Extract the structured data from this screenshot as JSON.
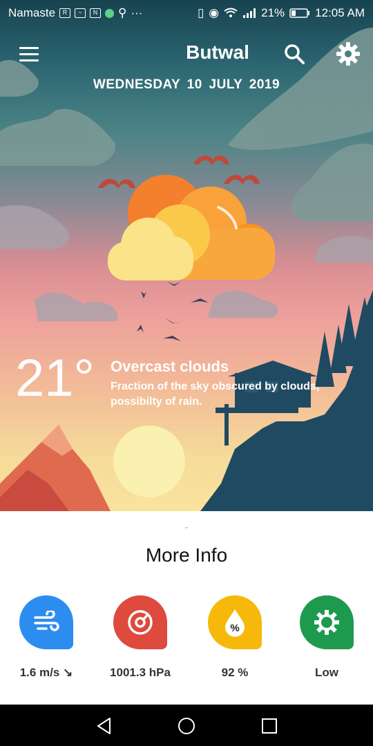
{
  "status_bar": {
    "carrier": "Namaste",
    "battery": "21%",
    "time": "12:05 AM"
  },
  "header": {
    "city": "Butwal",
    "date": "WEDNESDAY 10 JULY 2019"
  },
  "current": {
    "temperature": "21°",
    "condition": "Overcast clouds",
    "description": "Fraction of the sky obscured by clouds, possibilty of rain."
  },
  "more_info": {
    "title": "More Info",
    "items": [
      {
        "icon": "wind-icon",
        "value": "1.6 m/s ↘",
        "color": "#2d8cf0"
      },
      {
        "icon": "pressure-icon",
        "value": "1001.3 hPa",
        "color": "#de4a3e"
      },
      {
        "icon": "humidity-icon",
        "value": "92 %",
        "color": "#f6b90b"
      },
      {
        "icon": "uv-icon",
        "value": "Low",
        "color": "#1e9a4f"
      }
    ]
  },
  "colors": {
    "sky_top": "#17434f",
    "sky_bottom": "#f8e39c",
    "cloud_orange": "#f7941d",
    "cloud_yellow": "#fbe38a"
  }
}
